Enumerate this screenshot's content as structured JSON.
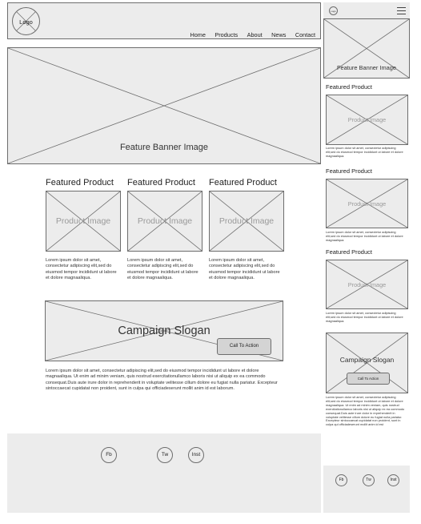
{
  "desktop": {
    "header": {
      "logo": "Logo",
      "nav": [
        "Home",
        "Products",
        "About",
        "News",
        "Contact"
      ]
    },
    "banner_label": "Feature Banner Image",
    "products": [
      {
        "title": "Featured Product",
        "image_label": "Product Image",
        "description": "Lorem ipsum dolor sit amet, consectetur adipiscing elit,sed do eiusmod tempor incididunt ut labore et dolore magnaaliqua."
      },
      {
        "title": "Featured Product",
        "image_label": "Product Image",
        "description": "Lorem ipsum dolor sit amet, consectetur adipiscing elit,sed do eiusmod tempor incididunt ut labore et dolore magnaaliqua."
      },
      {
        "title": "Featured Product",
        "image_label": "Product Image",
        "description": "Lorem ipsum dolor sit amet, consectetur adipiscing elit,sed do eiusmod tempor incididunt ut labore et dolore magnaaliqua."
      }
    ],
    "campaign": {
      "slogan": "Campaign Slogan",
      "cta": "Call To Action",
      "body": "Lorem ipsum dolor sit amet, consectetur adipiscing elit,sed do eiusmod tempor incididunt ut labore et dolore magnaaliqua. Ut enim ad minim veniam, quis nostrud exercitationullamco laboris nisi ut aliquip ex ea commodo consequat.Duis aute irure dolor in reprehenderit in voluptate velitesse cillum dolore eu fugiat nulla pariatur. Excepteur sintoccaecat cupidatat non proident, sunt in culpa qui officiadeserunt mollit anim id est laborum."
    },
    "footer": {
      "social": [
        "Fb",
        "Tw",
        "Inst"
      ]
    }
  },
  "mobile": {
    "header": {
      "logo": "Logo"
    },
    "banner_label": "Feature Banner Image",
    "products": [
      {
        "title": "Featured Product",
        "image_label": "Product Image",
        "description": "Lorem ipsum dolor sit amet, consectetur adipiscing elit,sed do eiusmod tempor incididunt ut labore et dolore magnaaliqua."
      },
      {
        "title": "Featured Product",
        "image_label": "Product Image",
        "description": "Lorem ipsum dolor sit amet, consectetur adipiscing elit,sed do eiusmod tempor incididunt ut labore et dolore magnaaliqua."
      },
      {
        "title": "Featured Product",
        "image_label": "Product Image",
        "description": "Lorem ipsum dolor sit amet, consectetur adipiscing elit,sed do eiusmod tempor incididunt ut labore et dolore magnaaliqua."
      }
    ],
    "campaign": {
      "slogan": "Campaign Slogan",
      "cta": "Call To Action",
      "body": "Lorem ipsum dolor sit amet, consectetur adipiscing elit,sed do eiusmod tempor incididunt ut labore et dolore magnaaliqua. Ut enim ad minim veniam, quis nostrud exercitationullamco laboris nisi ut aliquip ex ea commodo consequat.Duis aute irure dolor in reprehenderit in voluptate velitesse cillum dolore eu fugiat nulla pariatur. Excepteur sintoccaecat cupidatat non proident, sunt in culpa qui officiadeserunt mollit anim id est"
    },
    "footer": {
      "social": [
        "Fb",
        "Tw",
        "Inst"
      ]
    }
  }
}
